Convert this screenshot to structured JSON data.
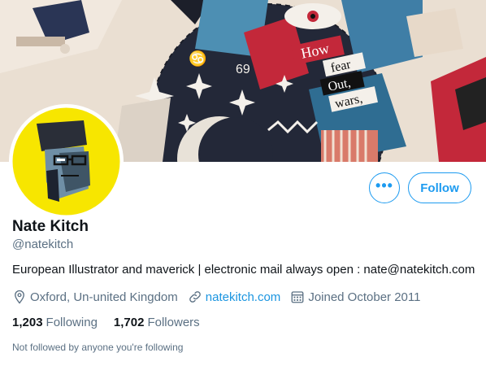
{
  "profile": {
    "name": "Nate Kitch",
    "handle": "@natekitch",
    "bio": "European Illustrator and maverick | electronic mail always open : nate@natekitch.com",
    "location": "Oxford, Un-united Kingdom",
    "website": "natekitch.com",
    "joined": "Joined October 2011"
  },
  "stats": {
    "following_count": "1,203",
    "following_label": "Following",
    "followers_count": "1,702",
    "followers_label": "Followers"
  },
  "actions": {
    "more_label": "•••",
    "follow_label": "Follow"
  },
  "social_context": "Not followed by anyone you're following",
  "banner": {
    "poster_words": [
      "How",
      "fear",
      "Out,",
      "wars,"
    ]
  },
  "icons": {
    "location": "location-pin-icon",
    "link": "link-icon",
    "calendar": "calendar-icon"
  },
  "colors": {
    "accent": "#1d9bf0",
    "secondary_text": "#5b7083",
    "link": "#1b95e0",
    "avatar_bg": "#f7e600"
  }
}
